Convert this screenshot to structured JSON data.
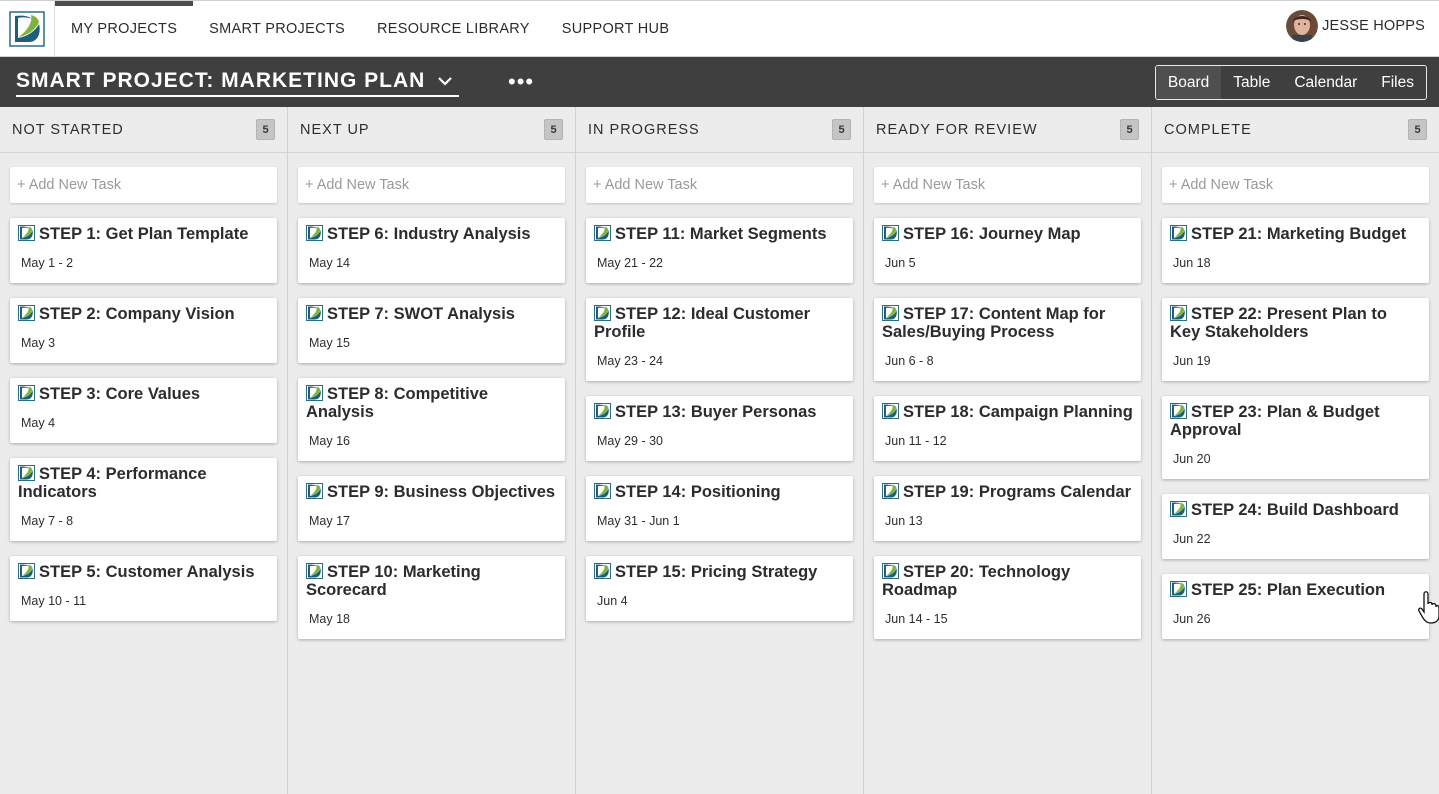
{
  "nav": {
    "items": [
      {
        "label": "MY PROJECTS",
        "active": true
      },
      {
        "label": "SMART PROJECTS",
        "active": false
      },
      {
        "label": "RESOURCE LIBRARY",
        "active": false
      },
      {
        "label": "SUPPORT HUB",
        "active": false
      }
    ],
    "user_name": "JESSE HOPPS"
  },
  "project": {
    "title": "SMART PROJECT: MARKETING PLAN",
    "more_label": "•••",
    "views": [
      {
        "label": "Board",
        "active": true
      },
      {
        "label": "Table",
        "active": false
      },
      {
        "label": "Calendar",
        "active": false
      },
      {
        "label": "Files",
        "active": false
      }
    ]
  },
  "add_task_label": "+ Add New Task",
  "columns": [
    {
      "title": "NOT STARTED",
      "count": "5",
      "cards": [
        {
          "title": "STEP 1: Get Plan Template",
          "date": "May 1 - 2"
        },
        {
          "title": "STEP 2: Company Vision",
          "date": "May 3"
        },
        {
          "title": "STEP 3: Core Values",
          "date": "May 4"
        },
        {
          "title": "STEP 4: Performance Indicators",
          "date": "May 7 - 8"
        },
        {
          "title": "STEP 5: Customer Analysis",
          "date": "May 10 - 11"
        }
      ]
    },
    {
      "title": "NEXT UP",
      "count": "5",
      "cards": [
        {
          "title": "STEP 6: Industry Analysis",
          "date": "May 14"
        },
        {
          "title": "STEP 7: SWOT Analysis",
          "date": "May 15"
        },
        {
          "title": "STEP 8: Competitive Analysis",
          "date": "May 16"
        },
        {
          "title": "STEP 9: Business Objectives",
          "date": "May 17"
        },
        {
          "title": "STEP 10: Marketing Scorecard",
          "date": "May 18"
        }
      ]
    },
    {
      "title": "IN PROGRESS",
      "count": "5",
      "cards": [
        {
          "title": "STEP 11: Market Segments",
          "date": "May 21 - 22"
        },
        {
          "title": "STEP 12: Ideal Customer Profile",
          "date": "May 23 - 24"
        },
        {
          "title": "STEP 13: Buyer Personas",
          "date": "May 29 - 30"
        },
        {
          "title": "STEP 14: Positioning",
          "date": "May 31 - Jun 1"
        },
        {
          "title": "STEP 15: Pricing Strategy",
          "date": "Jun 4"
        }
      ]
    },
    {
      "title": "READY FOR REVIEW",
      "count": "5",
      "cards": [
        {
          "title": "STEP 16: Journey Map",
          "date": "Jun 5"
        },
        {
          "title": "STEP 17: Content Map for Sales/Buying Process",
          "date": "Jun 6 - 8"
        },
        {
          "title": "STEP 18: Campaign Planning",
          "date": "Jun 11 - 12"
        },
        {
          "title": "STEP 19: Programs Calendar",
          "date": "Jun 13"
        },
        {
          "title": "STEP 20: Technology Roadmap",
          "date": "Jun 14 - 15"
        }
      ]
    },
    {
      "title": "COMPLETE",
      "count": "5",
      "cards": [
        {
          "title": "STEP 21: Marketing Budget",
          "date": "Jun 18"
        },
        {
          "title": "STEP 22: Present Plan to Key Stakeholders",
          "date": "Jun 19"
        },
        {
          "title": "STEP 23: Plan & Budget Approval",
          "date": "Jun 20"
        },
        {
          "title": "STEP 24: Build Dashboard",
          "date": "Jun 22"
        },
        {
          "title": "STEP 25: Plan Execution",
          "date": "Jun 26"
        }
      ]
    }
  ],
  "icons": {
    "logo": "brand-logo-icon",
    "card": "task-leaf-icon",
    "dropdown": "chevron-down-icon",
    "cursor": "hand-cursor-icon"
  },
  "colors": {
    "brand_dark": "#1f5f7a",
    "brand_green": "#7fb33b",
    "header_bg": "#3f3f3f",
    "board_bg": "#ececec"
  }
}
